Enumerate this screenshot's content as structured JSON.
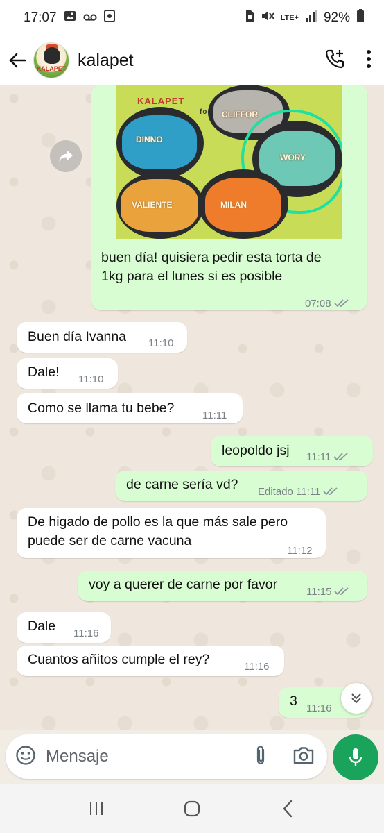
{
  "status": {
    "time": "17:07",
    "network": "LTE+",
    "battery": "92%",
    "icons": [
      "gallery-icon",
      "voicemail-icon",
      "screenshot-icon",
      "sim-icon",
      "mute-icon",
      "signal-icon",
      "battery-icon"
    ]
  },
  "header": {
    "name": "kalapet",
    "avatar_text": "KALAPET",
    "actions": [
      "add-call-icon",
      "more-icon"
    ]
  },
  "image_message": {
    "photo_text": {
      "brand": "KALAPET",
      "sub": "food",
      "names": [
        "DINNO",
        "CLIFFOR",
        "WORY",
        "VALIENTE",
        "MILAN"
      ]
    },
    "caption_line1": "buen día! quisiera pedir esta torta de",
    "caption_line2": "1kg para el lunes si es posible",
    "time": "07:08"
  },
  "messages": [
    {
      "dir": "in",
      "text": "Buen día Ivanna",
      "time": "11:10"
    },
    {
      "dir": "in",
      "text": "Dale!",
      "time": "11:10"
    },
    {
      "dir": "in",
      "text": "Como se llama tu bebe?",
      "time": "11:11"
    },
    {
      "dir": "out",
      "text": "leopoldo jsj",
      "time": "11:11"
    },
    {
      "dir": "out",
      "text": "de carne sería vd?",
      "edited": "Editado",
      "time": "11:11"
    },
    {
      "dir": "in",
      "text_line1": "De higado de pollo es la que más sale pero",
      "text_line2": "puede ser de carne vacuna",
      "time": "11:12"
    },
    {
      "dir": "out",
      "text": "voy a querer de carne por favor",
      "time": "11:15"
    },
    {
      "dir": "in",
      "text": "Dale",
      "time": "11:16"
    },
    {
      "dir": "in",
      "text": "Cuantos añitos cumple el rey?",
      "time": "11:16"
    },
    {
      "dir": "out",
      "text": "3",
      "time": "11:16"
    }
  ],
  "composer": {
    "placeholder": "Mensaje",
    "icons": [
      "emoji-icon",
      "attach-icon",
      "camera-icon",
      "mic-icon"
    ]
  },
  "colors": {
    "outgoing": "#d9fdd3",
    "incoming": "#ffffff",
    "accent": "#1aa35b",
    "ticks": "#8a949c"
  }
}
